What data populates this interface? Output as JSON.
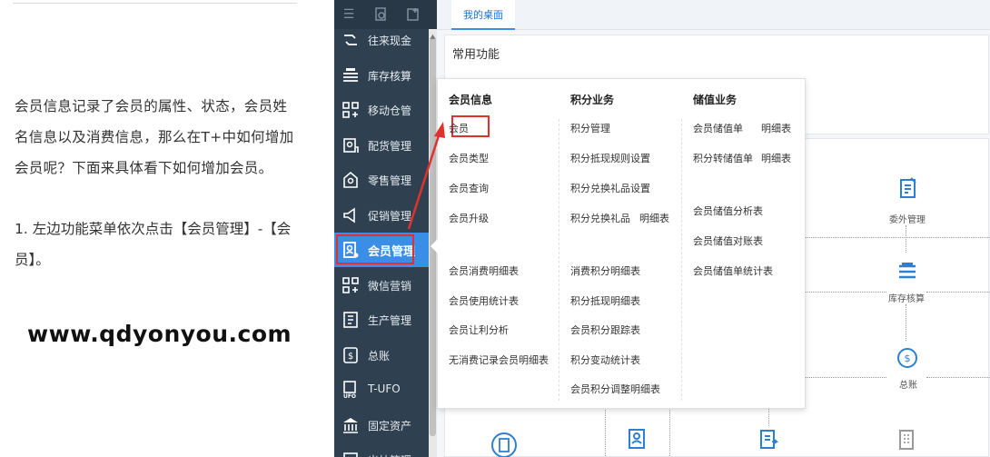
{
  "article": {
    "paragraph": "会员信息记录了会员的属性、状态，会员姓名信息以及消费信息，那么在T+中如何增加会员呢？下面来具体看下如何增加会员。",
    "step1": "1.  左边功能菜单依次点击【会员管理】-【会员】。",
    "website": "www.qdyonyou.com"
  },
  "sidebar": {
    "items": [
      {
        "label": "往来现金",
        "icon": "cash-icon"
      },
      {
        "label": "库存核算",
        "icon": "inventory-icon"
      },
      {
        "label": "移动仓管",
        "icon": "mobile-warehouse-icon"
      },
      {
        "label": "配货管理",
        "icon": "distribution-icon"
      },
      {
        "label": "零售管理",
        "icon": "retail-icon"
      },
      {
        "label": "促销管理",
        "icon": "promotion-icon"
      },
      {
        "label": "会员管理",
        "icon": "member-icon"
      },
      {
        "label": "微信营销",
        "icon": "wechat-icon"
      },
      {
        "label": "生产管理",
        "icon": "production-icon"
      },
      {
        "label": "总账",
        "icon": "ledger-icon"
      },
      {
        "label": "T-UFO",
        "icon": "ufo-icon"
      },
      {
        "label": "固定资产",
        "icon": "fixed-assets-icon"
      },
      {
        "label": "出纳管理",
        "icon": "cashier-icon"
      }
    ],
    "active_index": 6
  },
  "main": {
    "tab_label": "我的桌面",
    "panel_title": "常用功能",
    "flow": {
      "outsourcing": "委外管理",
      "inventory": "库存核算",
      "ledger": "总账"
    }
  },
  "dropdown": {
    "col1": {
      "heading": "会员信息",
      "items_top": [
        "会员",
        "会员类型",
        "会员查询",
        "会员升级"
      ],
      "items_bottom": [
        "会员消费明细表",
        "会员使用统计表",
        "会员让利分析",
        "无消费记录会员明细表"
      ]
    },
    "col2": {
      "heading": "积分业务",
      "items_top": [
        "积分管理",
        "积分抵现规则设置",
        "积分兑换礼品设置",
        "积分兑换礼品"
      ],
      "items_top_suffix": "明细表",
      "items_bottom": [
        "消费积分明细表",
        "积分抵现明细表",
        "会员积分跟踪表",
        "积分变动统计表",
        "会员积分调整明细表"
      ]
    },
    "col3": {
      "heading": "储值业务",
      "items_top": [
        "会员储值单",
        "积分转储值单"
      ],
      "items_top_suffix": "明细表",
      "items_mid": [
        "会员储值分析表",
        "会员储值对账表",
        "会员储值单统计表"
      ]
    }
  },
  "colors": {
    "sidebar_bg": "#2f4050",
    "active_bg": "#3a8ee6",
    "highlight_red": "#e0322d",
    "icon_blue": "#2d7fd3"
  }
}
